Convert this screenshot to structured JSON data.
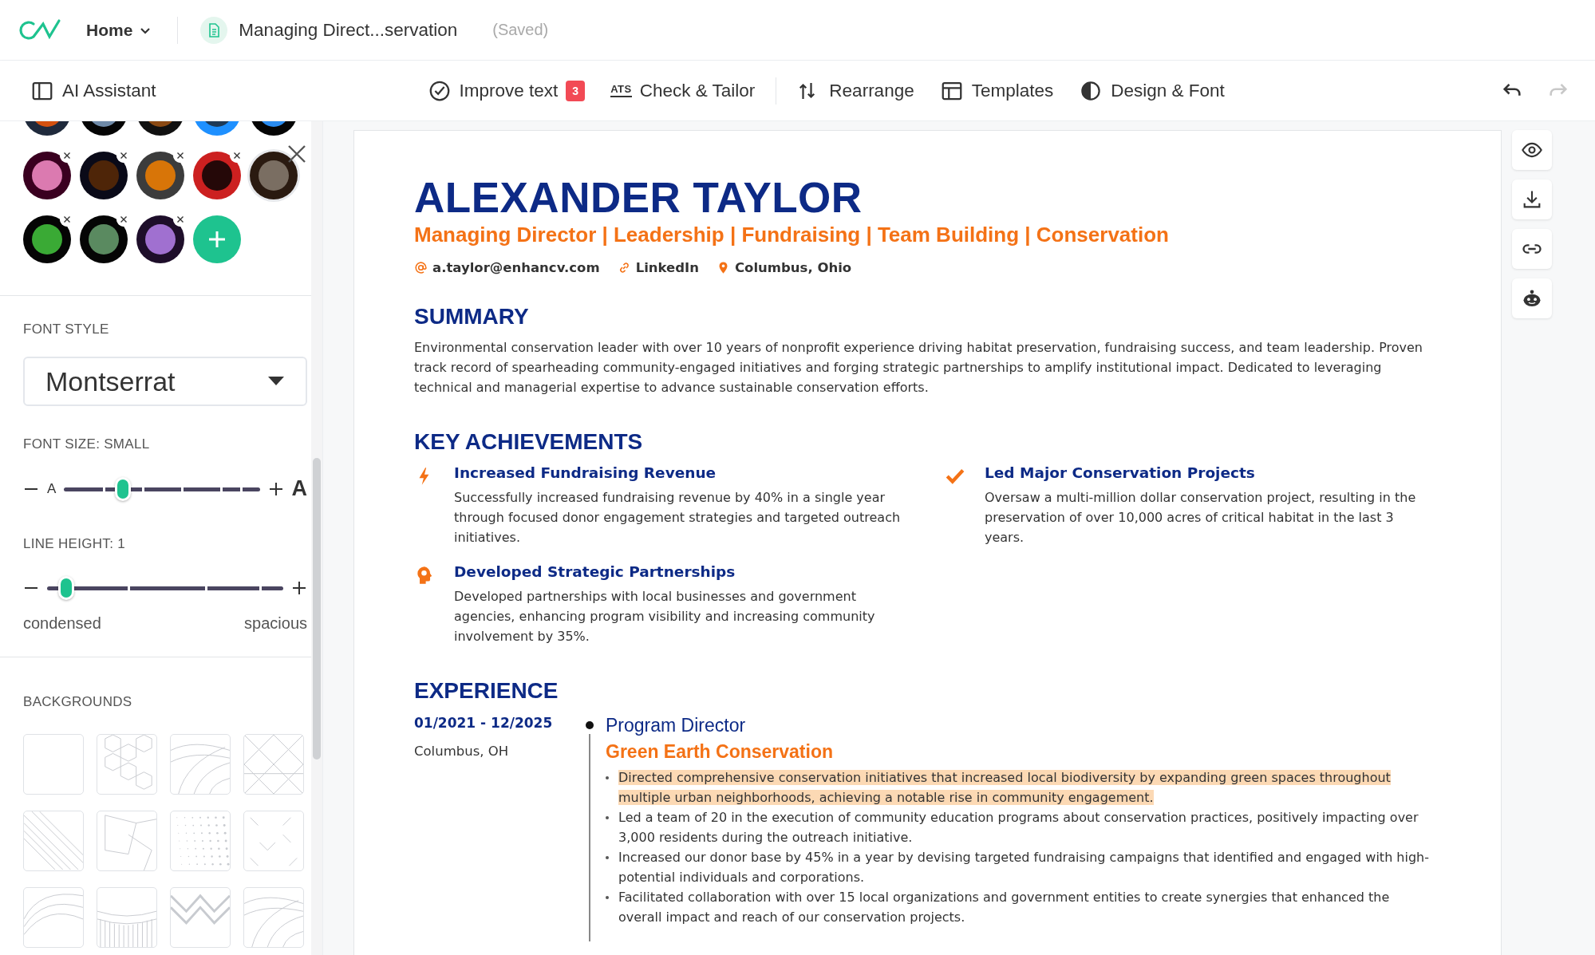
{
  "topbar": {
    "home": "Home",
    "document_title": "Managing Direct...servation",
    "status": "(Saved)"
  },
  "toolbar": {
    "assistant": "AI Assistant",
    "tools": [
      {
        "label": "Improve text",
        "badge": "3"
      },
      {
        "label": "Check & Tailor",
        "icon_text": "ATS"
      },
      {
        "label": "Rearrange"
      },
      {
        "label": "Templates"
      },
      {
        "label": "Design & Font"
      }
    ],
    "undo": {
      "disabled": false
    },
    "redo": {
      "disabled": true
    }
  },
  "design_panel": {
    "swatches": [
      {
        "ring": {
          "color": "#1f2a3c"
        },
        "color": "#d4510f",
        "hovered": false
      },
      {
        "ring": {
          "color": "#050505"
        },
        "color": "#6f8aa8",
        "hovered": false
      },
      {
        "ring": {
          "color": "#111111"
        },
        "color": "#8a4a14",
        "hovered": false
      },
      {
        "ring": {
          "color": "#1e90ff"
        },
        "color": "#1f3a56",
        "hovered": false
      },
      {
        "ring": {
          "color": "#050505"
        },
        "color": "#2a8cf0",
        "hovered": false
      },
      {
        "ring": {
          "color": "#3a0020"
        },
        "color": "#db7ab0",
        "hovered": false
      },
      {
        "ring": {
          "color": "#0a0a18"
        },
        "color": "#4e2508",
        "hovered": false
      },
      {
        "ring": {
          "color": "#3c3c3c"
        },
        "color": "#d87508",
        "hovered": false
      },
      {
        "ring": {
          "color": "#cc2020"
        },
        "color": "#250808",
        "hovered": false
      },
      {
        "ring": {
          "color": "#2a1a10"
        },
        "color": "#7a6e62",
        "hovered": true
      },
      {
        "ring": {
          "color": "#050505"
        },
        "color": "#3aaa35",
        "hovered": false
      },
      {
        "ring": {
          "color": "#050505"
        },
        "color": "#5a8a60",
        "hovered": false
      },
      {
        "ring": {
          "color": "#1e0e2a"
        },
        "color": "#a070d0",
        "hovered": false
      }
    ],
    "font_style": {
      "label": "FONT STYLE",
      "value": "Montserrat"
    },
    "font_size": {
      "label": "FONT SIZE: SMALL",
      "min_label": "A",
      "max_label": "A",
      "level": 0.3
    },
    "line_height": {
      "label": "LINE HEIGHT: 1",
      "level": 0.08,
      "min_caption": "condensed",
      "max_caption": "spacious"
    },
    "backgrounds": {
      "label": "BACKGROUNDS",
      "tiles": [
        {
          "kind": "blank"
        },
        {
          "kind": "hexagons"
        },
        {
          "kind": "contours"
        },
        {
          "kind": "lattice"
        },
        {
          "kind": "diagonals"
        },
        {
          "kind": "polygons"
        },
        {
          "kind": "dots"
        },
        {
          "kind": "chevrons"
        },
        {
          "kind": "waves"
        },
        {
          "kind": "stripes"
        },
        {
          "kind": "zigzag"
        },
        {
          "kind": "contours"
        }
      ]
    }
  },
  "resume": {
    "name": "ALEXANDER TAYLOR",
    "headline": "Managing Director | Leadership | Fundraising | Team Building | Conservation",
    "contacts": [
      {
        "text": "a.taylor@enhancv.com"
      },
      {
        "text": "LinkedIn"
      },
      {
        "text": "Columbus, Ohio"
      }
    ],
    "summary": {
      "heading": "SUMMARY",
      "text": "Environmental conservation leader with over 10 years of nonprofit experience driving habitat preservation, fundraising success, and team leadership. Proven track record of spearheading community-engaged initiatives and forging strategic partnerships to amplify institutional impact. Dedicated to leveraging technical and managerial expertise to advance sustainable conservation efforts."
    },
    "achievements": {
      "heading": "KEY ACHIEVEMENTS",
      "items": [
        {
          "title": "Increased Fundraising Revenue",
          "text": "Successfully increased fundraising revenue by 40% in a single year through focused donor engagement strategies and targeted outreach initiatives."
        },
        {
          "title": "Led Major Conservation Projects",
          "text": "Oversaw a multi-million dollar conservation project, resulting in the preservation of over 10,000 acres of critical habitat in the last 3 years."
        },
        {
          "title": "Developed Strategic Partnerships",
          "text": "Developed partnerships with local businesses and government agencies, enhancing program visibility and increasing community involvement by 35%."
        }
      ]
    },
    "experience": {
      "heading": "EXPERIENCE",
      "entries": [
        {
          "dates": "01/2021 - 12/2025",
          "location": "Columbus, OH",
          "role": "Program Director",
          "company": "Green Earth Conservation",
          "bullets": [
            {
              "text": "Directed comprehensive conservation initiatives that increased local biodiversity by expanding green spaces throughout multiple urban neighborhoods, achieving a notable rise in community engagement.",
              "highlighted": true
            },
            {
              "text": "Led a team of 20 in the execution of community education programs about conservation practices, positively impacting over 3,000 residents during the outreach initiative.",
              "highlighted": false
            },
            {
              "text": "Increased our donor base by 45% in a year by devising targeted fundraising campaigns that identified and engaged with high-potential individuals and corporations.",
              "highlighted": false
            },
            {
              "text": "Facilitated collaboration with over 15 local organizations and government entities to create synergies that enhanced the overall impact and reach of our conservation projects.",
              "highlighted": false
            }
          ]
        }
      ]
    }
  }
}
